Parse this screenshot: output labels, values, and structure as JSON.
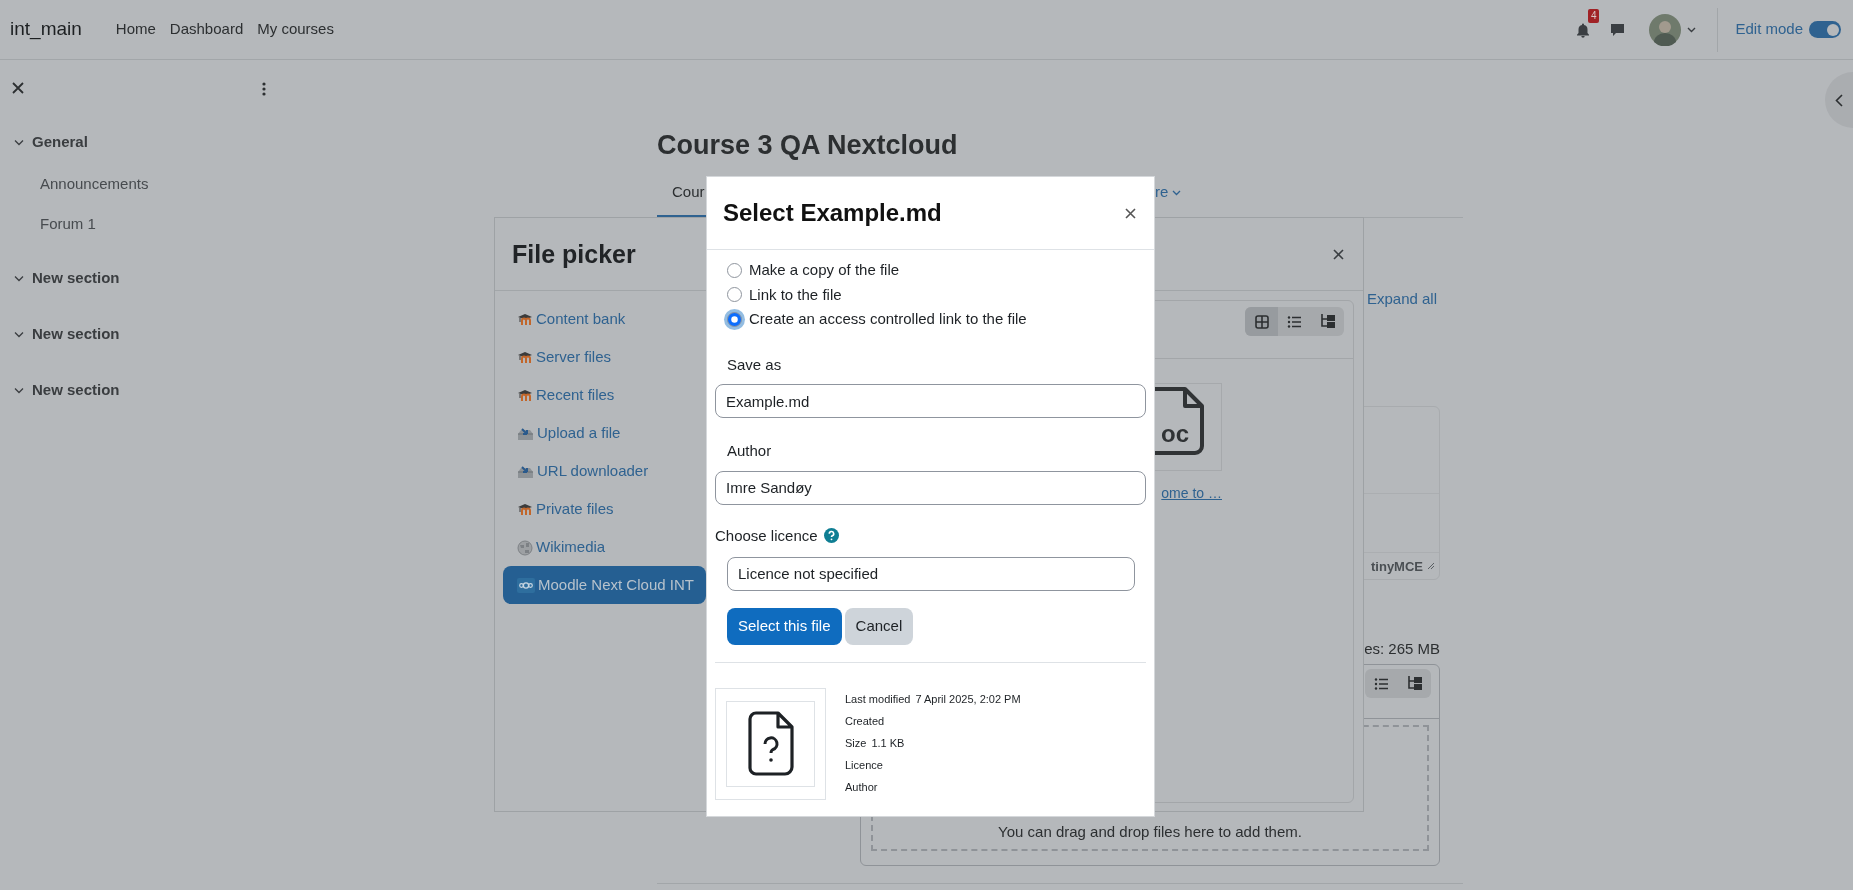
{
  "navbar": {
    "brand": "int_main",
    "links": [
      "Home",
      "Dashboard",
      "My courses"
    ],
    "notification_count": "4",
    "edit_mode": {
      "label": "Edit mode",
      "on": true
    }
  },
  "sidebar": {
    "sections": [
      {
        "title": "General",
        "expanded": true,
        "items": [
          "Announcements",
          "Forum 1"
        ]
      },
      {
        "title": "New section",
        "expanded": true
      },
      {
        "title": "New section",
        "expanded": true
      },
      {
        "title": "New section",
        "expanded": true
      }
    ]
  },
  "course": {
    "title": "Course 3 QA Nextcloud",
    "tabs": [
      {
        "label": "Cour",
        "selected": true,
        "kind": "plain"
      },
      {
        "label": "re",
        "selected": false,
        "kind": "dropdown"
      }
    ],
    "expand_all": "Expand all",
    "editor": {
      "status": "tinyMCE"
    },
    "filemanager": {
      "max_size": "es: 265 MB",
      "views": [
        {
          "kind": "list"
        },
        {
          "kind": "tree"
        }
      ],
      "drop_hint": "You can drag and drop files here to add them."
    }
  },
  "file_picker": {
    "title": "File picker",
    "repositories": [
      {
        "label": "Content bank",
        "kind": "moodle",
        "selected": false
      },
      {
        "label": "Server files",
        "kind": "moodle",
        "selected": false
      },
      {
        "label": "Recent files",
        "kind": "moodle",
        "selected": false
      },
      {
        "label": "Upload a file",
        "kind": "upload",
        "selected": false
      },
      {
        "label": "URL downloader",
        "kind": "upload",
        "selected": false
      },
      {
        "label": "Private files",
        "kind": "moodle",
        "selected": false
      },
      {
        "label": "Wikimedia",
        "kind": "globe",
        "selected": false
      },
      {
        "label": "Moodle Next Cloud INT",
        "kind": "cloud",
        "selected": true
      }
    ],
    "views": [
      {
        "kind": "icons",
        "selected": true
      },
      {
        "kind": "list",
        "selected": false
      },
      {
        "kind": "tree",
        "selected": false
      }
    ],
    "file": {
      "icon_text": "oc",
      "label": "ome to …"
    }
  },
  "dialog": {
    "title": "Select Example.md",
    "options": [
      {
        "label": "Make a copy of the file",
        "selected": false
      },
      {
        "label": "Link to the file",
        "selected": false
      },
      {
        "label": "Create an access controlled link to the file",
        "selected": true
      }
    ],
    "fields": [
      {
        "label": "Save as",
        "value": "Example.md"
      },
      {
        "label": "Author",
        "value": "Imre Sandøy"
      }
    ],
    "licence": {
      "label": "Choose licence",
      "value": "Licence not specified"
    },
    "buttons": [
      {
        "label": "Select this file",
        "kind": "primary"
      },
      {
        "label": "Cancel",
        "kind": "secondary"
      }
    ],
    "details": [
      {
        "label": "Last modified",
        "value": "7 April 2025, 2:02 PM"
      },
      {
        "label": "Created"
      },
      {
        "label": "Size",
        "value": "1.1 KB"
      },
      {
        "label": "Licence"
      },
      {
        "label": "Author"
      }
    ]
  }
}
